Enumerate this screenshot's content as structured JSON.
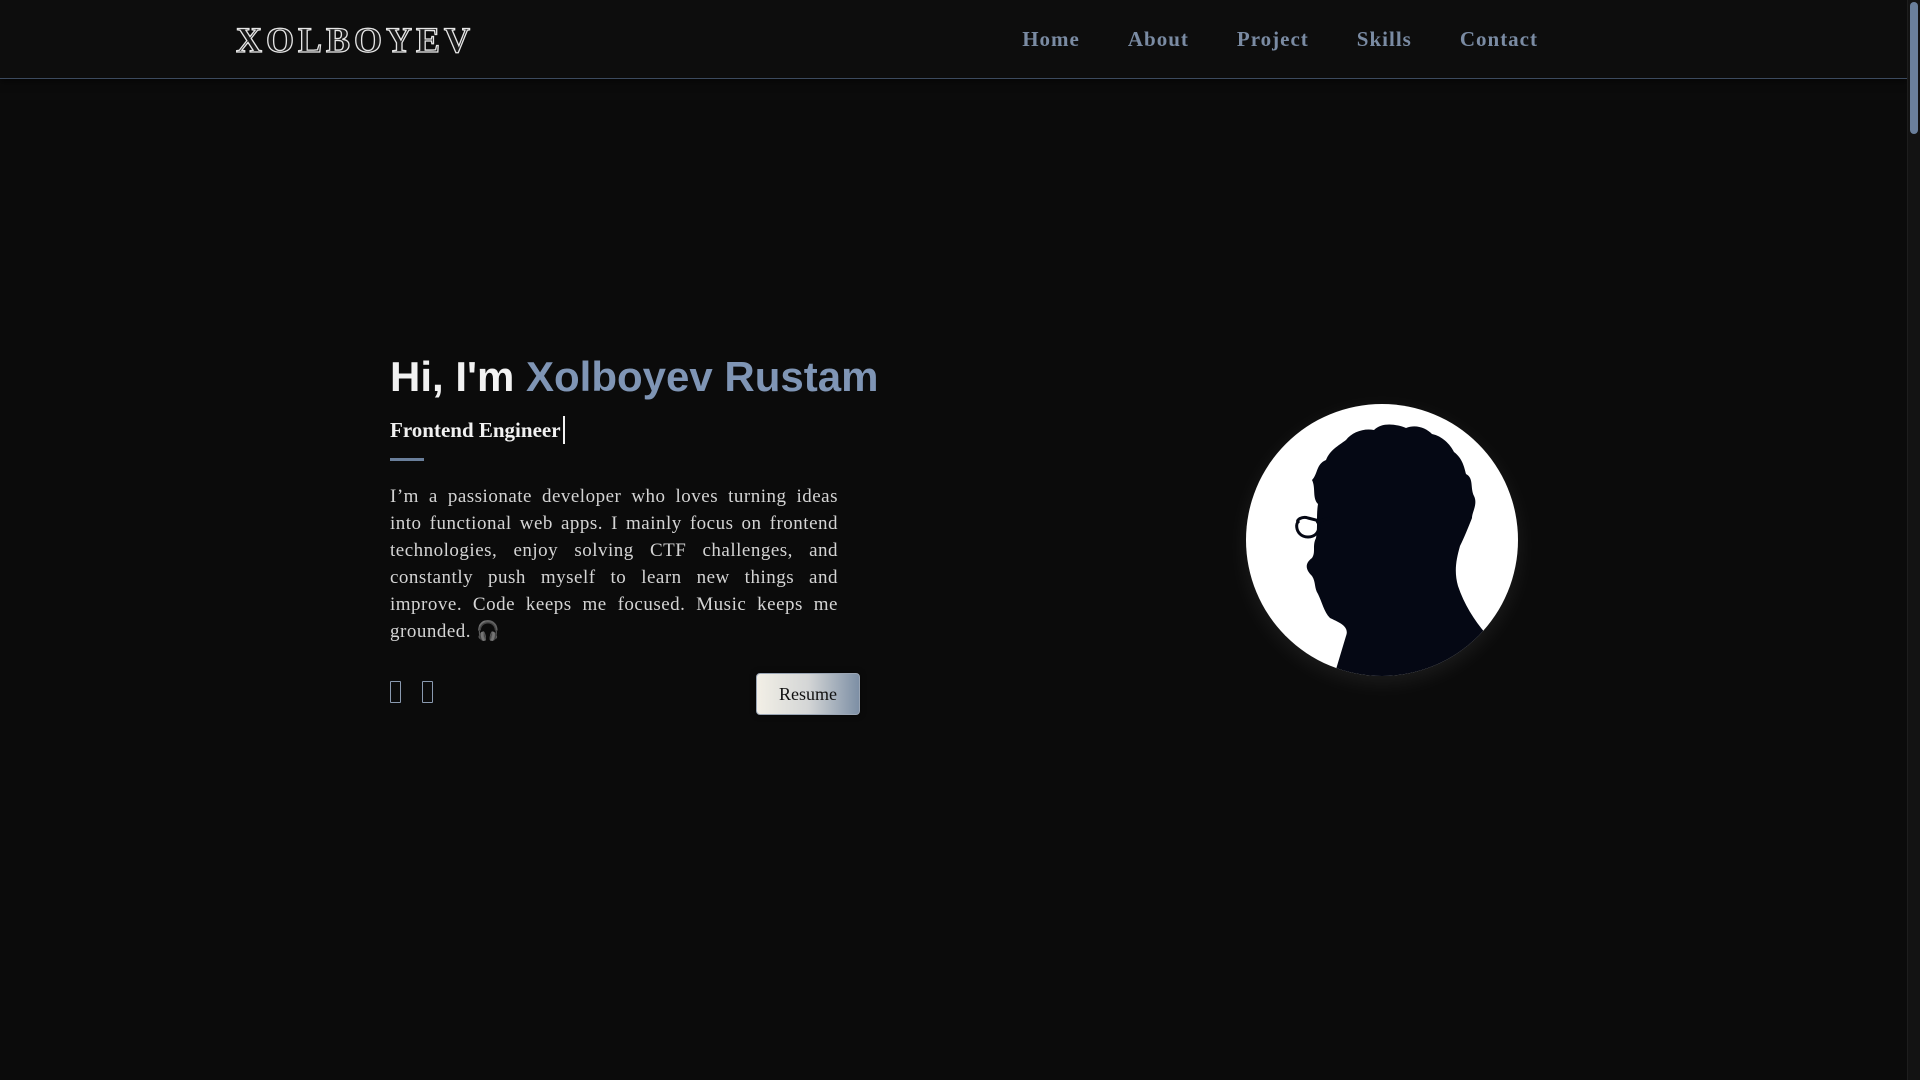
{
  "navbar": {
    "logo": "XOLBOYEV",
    "links": [
      "Home",
      "About",
      "Project",
      "Skills",
      "Contact"
    ]
  },
  "hero": {
    "greeting": "Hi, I'm ",
    "name": "Xolboyev Rustam",
    "role": "Frontend Engineer",
    "bio": "I’m a passionate developer who loves turning ideas into functional web apps. I mainly focus on frontend technologies, enjoy solving CTF challenges, and constantly push myself to learn new things and improve. Code keeps me focused. Music keeps me grounded. 🎧",
    "resume_label": "Resume",
    "social_icons": [
      "github-icon",
      "linkedin-icon"
    ]
  },
  "colors": {
    "background": "#0b0b0b",
    "accent": "#7f95b5",
    "nav_link": "#7a8ba3",
    "text": "#f2f2f2"
  }
}
